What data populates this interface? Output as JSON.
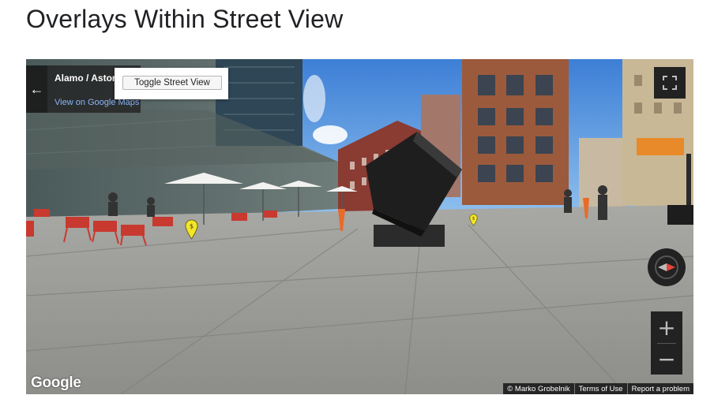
{
  "page": {
    "title": "Overlays Within Street View"
  },
  "street_view": {
    "address": "Alamo / Astor",
    "view_link": "View on Google Maps",
    "toggle_button": "Toggle Street View",
    "logo": "Google",
    "copyright": "© Marko Grobelnik",
    "terms": "Terms of Use",
    "report": "Report a problem",
    "markers": [
      {
        "label": "$"
      },
      {
        "label": "$"
      }
    ],
    "icons": {
      "back": "arrow-left-icon",
      "fullscreen": "fullscreen-icon",
      "compass": "compass-icon",
      "zoom_in": "plus-icon",
      "zoom_out": "minus-icon",
      "marker": "map-pin-icon"
    },
    "colors": {
      "control_bg": "#222222",
      "marker": "#f5e626",
      "link": "#8ab4f8"
    }
  },
  "zoom": {
    "in_label": "+",
    "out_label": "−"
  }
}
